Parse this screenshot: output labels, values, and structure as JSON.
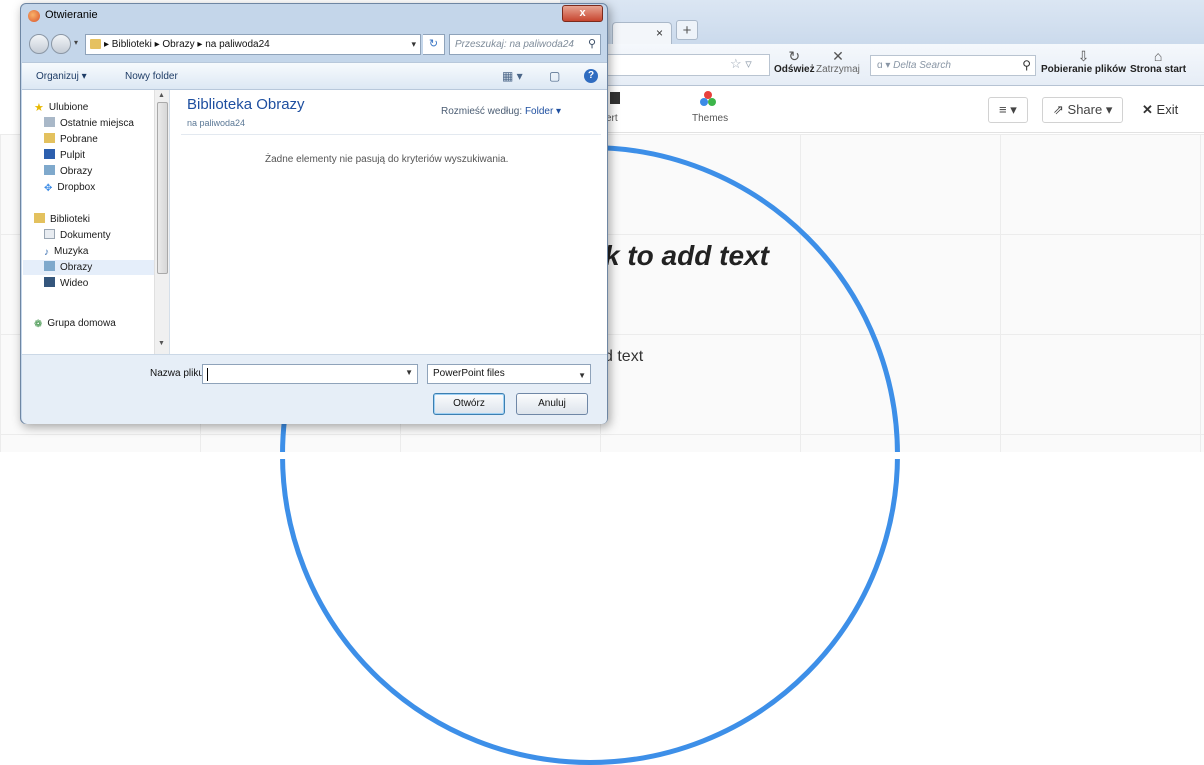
{
  "dialog": {
    "title": "Otwieranie",
    "close": "x",
    "nav": {
      "breadcrumb": "▸ Biblioteki ▸ Obrazy ▸ na paliwoda24",
      "search_placeholder": "Przeszukaj: na paliwoda24"
    },
    "commands": {
      "organize": "Organizuj ▾",
      "new_folder": "Nowy folder"
    },
    "nav_pane": {
      "favorites": "Ulubione",
      "favorites_items": [
        "Ostatnie miejsca",
        "Pobrane",
        "Pulpit",
        "Obrazy",
        "Dropbox"
      ],
      "libraries": "Biblioteki",
      "libraries_items": [
        "Dokumenty",
        "Muzyka",
        "Obrazy",
        "Wideo"
      ],
      "homegroup": "Grupa domowa"
    },
    "content": {
      "title": "Biblioteka Obrazy",
      "subtitle": "na paliwoda24",
      "arrange_label": "Rozmieść według:",
      "arrange_value": "Folder ▾",
      "empty_message": "Żadne elementy nie pasują do kryteriów wyszukiwania."
    },
    "bottom": {
      "filename_label": "Nazwa pliku:",
      "filename_value": "",
      "filetype": "PowerPoint files",
      "open": "Otwórz",
      "cancel": "Anuluj"
    }
  },
  "browser": {
    "tab_close": "×",
    "new_tab": "+",
    "refresh": "Odśwież",
    "stop": "Zatrzymaj",
    "search_placeholder": "Delta Search",
    "downloads": "Pobieranie plików",
    "home": "Strona start"
  },
  "editor": {
    "insert_label": "ert",
    "themes_label": "Themes",
    "menu_btn": "≡ ▾",
    "share_btn": "Share ▾",
    "exit_btn": "Exit",
    "title_placeholder": "k to add text",
    "body_placeholder": "d text"
  },
  "colors": {
    "accent_circle": "#3d8fe8",
    "library_title": "#1e4fa0"
  }
}
